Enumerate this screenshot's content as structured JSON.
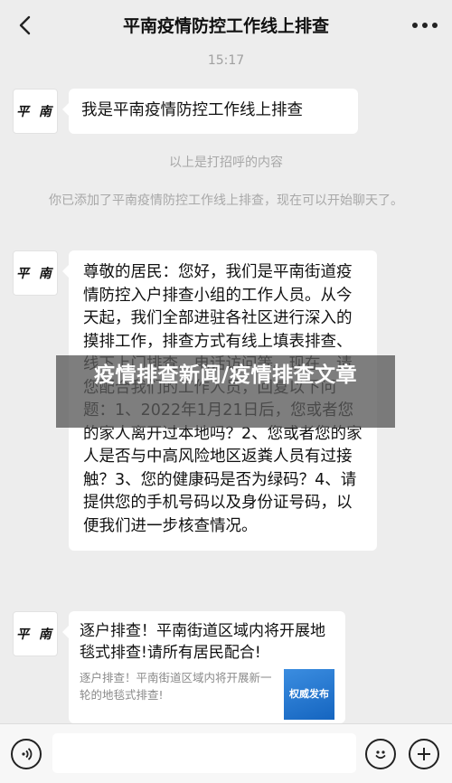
{
  "header": {
    "title": "平南疫情防控工作线上排查",
    "back_icon": "chevron-left-icon",
    "more_icon": "more-horizontal-icon"
  },
  "chat": {
    "timestamp": "15:17",
    "avatar_label": "平 南",
    "msg1": "我是平南疫情防控工作线上排查",
    "system1": "以上是打招呼的内容",
    "system2": "你已添加了平南疫情防控工作线上排查，现在可以开始聊天了。",
    "msg2": "尊敬的居民：您好，我们是平南街道疫情防控入户排查小组的工作人员。从今天起，我们全部进驻各社区进行深入的摸排工作，排查方式有线上填表排查、线下上门排查、电话访问等。现在，请您配合我们的工作人员，回复以下问题：1、2022年1月21日后，您或者您的家人离开过本地吗？2、您或者您的家人是否与中高风险地区返粪人员有过接触？3、您的健康码是否为绿码？4、请提供您的手机号码以及身份证号码，以便我们进一步核查情况。",
    "card": {
      "title": "逐户排查！平南街道区域内将开展地毯式排查!请所有居民配合!",
      "desc": "逐户排查！平南街道区域内将开展新一轮的地毯式排查!",
      "thumb_text": "权威发布"
    }
  },
  "overlay": {
    "text": "疫情排查新闻/疫情排查文章"
  },
  "inputbar": {
    "voice_icon": "voice-icon",
    "emoji_icon": "emoji-icon",
    "plus_icon": "plus-icon"
  }
}
